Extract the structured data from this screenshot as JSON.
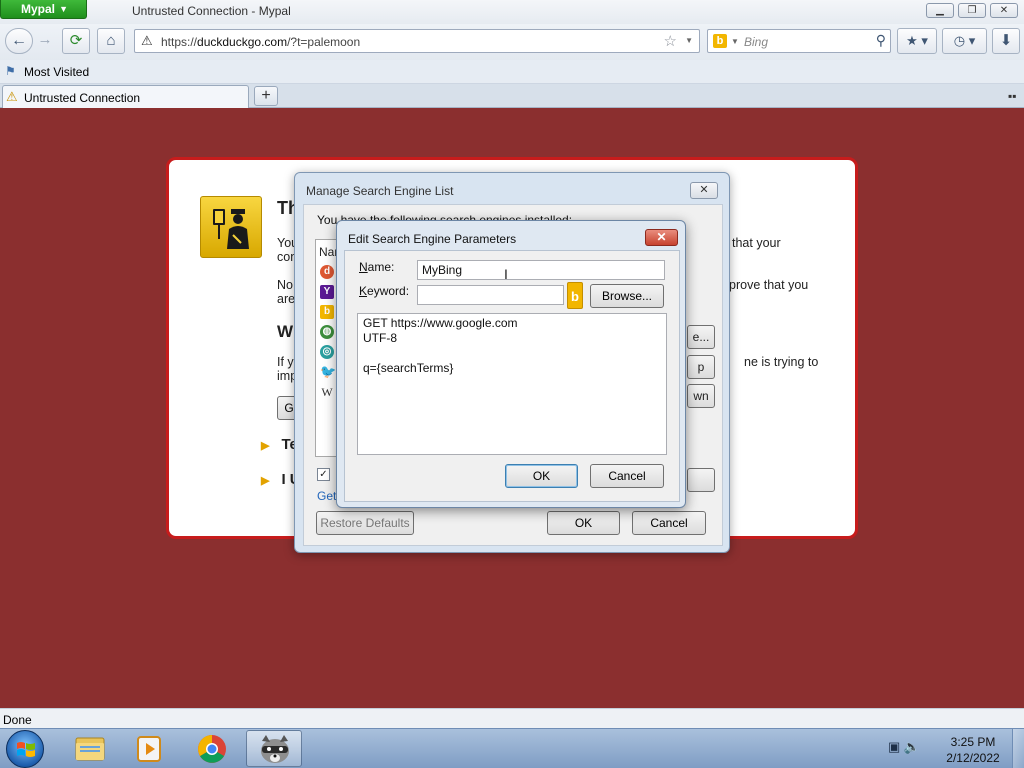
{
  "browser": {
    "app_button": "Mypal",
    "window_title": "Untrusted Connection - Mypal",
    "url_scheme": "https://",
    "url_host": "duckduckgo.com",
    "url_path": "/?t=palemoon",
    "search_engine": "Bing",
    "bookmark_item": "Most Visited",
    "tab_label": "Untrusted Connection",
    "accent_color": "#2aa52a"
  },
  "error_page": {
    "title_fragment": "Th",
    "line1_left": "You",
    "line1_right": "that your",
    "line2_left": "con",
    "line3_left": "No",
    "line3_right": "prove that you",
    "line4_left": "are",
    "heading2_fragment": "W",
    "line5_left": "If y",
    "line5_right": "ne is trying to",
    "line6_left": "imp",
    "button_fragment": "G",
    "expander1": "Te",
    "expander2": "I U",
    "background_color": "#8b2f2f"
  },
  "manage_dialog": {
    "title": "Manage Search Engine List",
    "intro": "You have the following search engines installed:",
    "list_header": "Nar",
    "get_more_fragment": "Get",
    "side_btn_edit_fragment": "e...",
    "side_btn_down_fragment": "wn",
    "restore_defaults": "Restore Defaults",
    "ok": "OK",
    "cancel": "Cancel",
    "engines": [
      "duckduckgo-icon",
      "yahoo-icon",
      "bing-icon",
      "globe-icon",
      "startpage-icon",
      "twitter-icon",
      "wikipedia-icon"
    ]
  },
  "edit_dialog": {
    "title": "Edit Search Engine Parameters",
    "name_label_first": "N",
    "name_label_rest": "ame:",
    "name_value": "MyBing",
    "keyword_label_first": "K",
    "keyword_label_rest": "eyword:",
    "keyword_value": "",
    "browse": "Browse...",
    "query_text": "GET https://www.google.com\nUTF-8\n\nq={searchTerms}",
    "ok": "OK",
    "cancel": "Cancel"
  },
  "status": {
    "text": "Done"
  },
  "taskbar": {
    "time": "3:25 PM",
    "date": "2/12/2022"
  }
}
